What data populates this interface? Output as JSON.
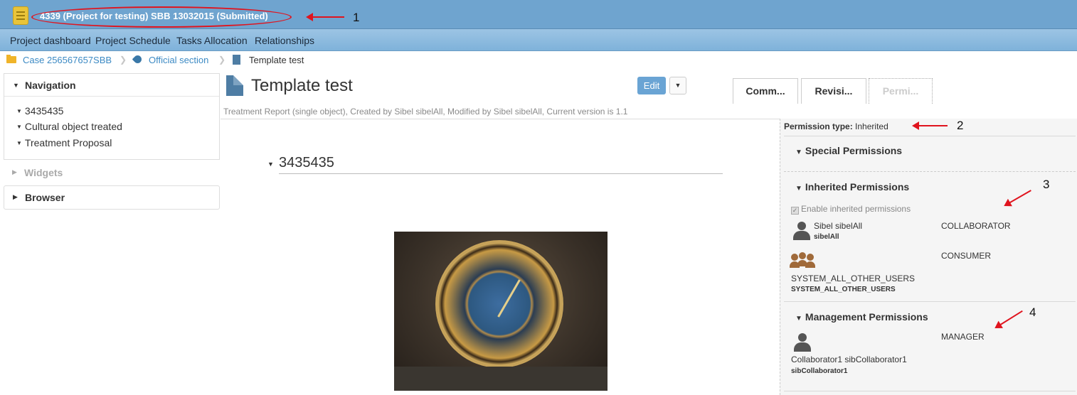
{
  "window": {
    "project_title": "4339 (Project for testing) SBB 13032015 (Submitted)"
  },
  "menu": {
    "items": [
      "Project dashboard",
      "Project Schedule",
      "Tasks Allocation",
      "Relationships"
    ]
  },
  "breadcrumb": {
    "case": "Case 256567657SBB",
    "section": "Official section",
    "current": "Template test"
  },
  "sidebar": {
    "navigation_label": "Navigation",
    "nav_items": [
      "3435435",
      "Cultural object treated",
      "Treatment Proposal"
    ],
    "widgets_label": "Widgets",
    "browser_label": "Browser"
  },
  "document": {
    "title": "Template test",
    "meta": "Treatment Report (single object), Created by Sibel sibelAll, Modified by Sibel sibelAll, Current version is 1.1",
    "edit_label": "Edit",
    "section_heading": "3435435"
  },
  "tabs": [
    "Comm...",
    "Revisi...",
    "Permi..."
  ],
  "permissions": {
    "type_label": "Permission type:",
    "type_value": "Inherited",
    "special_label": "Special Permissions",
    "inherited_label": "Inherited Permissions",
    "enable_inherited_label": "Enable inherited permissions",
    "inherited_entries": [
      {
        "name": "Sibel sibelAll",
        "sub": "sibelAll",
        "role": "COLLABORATOR",
        "icon": "user-icon"
      },
      {
        "name": "SYSTEM_ALL_OTHER_USERS",
        "sub": "SYSTEM_ALL_OTHER_USERS",
        "role": "CONSUMER",
        "icon": "group-icon"
      }
    ],
    "management_label": "Management Permissions",
    "management_entries": [
      {
        "name": "Collaborator1 sibCollaborator1",
        "sub": "sibCollaborator1",
        "role": "MANAGER",
        "icon": "user-icon"
      }
    ]
  },
  "annotations": [
    "1",
    "2",
    "3",
    "4"
  ],
  "colors": {
    "titlebar": "#6fa4cf",
    "menubar": "#8dbbe0",
    "link": "#3c8ac4",
    "annotation_red": "#e0141e",
    "edit_button": "#6aa4d4"
  }
}
